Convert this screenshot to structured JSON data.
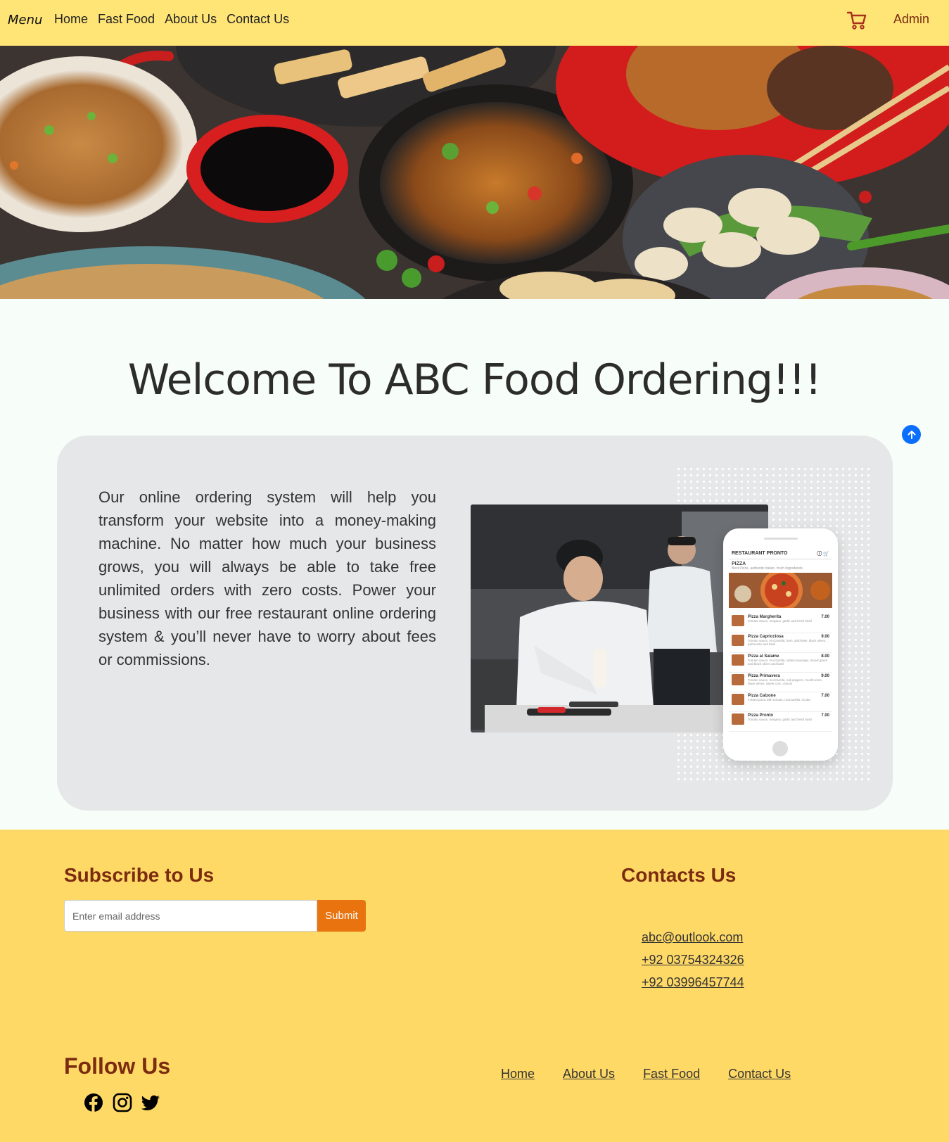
{
  "navbar": {
    "brand": "Menu",
    "links": [
      "Home",
      "Fast Food",
      "About Us",
      "Contact Us"
    ],
    "admin": "Admin",
    "cart_icon": "cart-icon",
    "accent_color": "#ffe476"
  },
  "hero": {
    "image": "food-dishes-banner"
  },
  "welcome": {
    "title": "Welcome To ABC Food Ordering!!!"
  },
  "about": {
    "text": "Our online ordering system will help you transform your website into a money-making machine. No matter how much your business grows, you will always be able to take free unlimited orders with zero costs. Power your business with our free restaurant online ordering system & you’ll never have to worry about fees or commissions.",
    "image": "chef-plating-photo",
    "phone": {
      "restaurant": "RESTAURANT PRONTO",
      "category": "PIZZA",
      "category_sub": "Best Pizza, authentic italian, fresh ingredients",
      "items": [
        {
          "name": "Pizza Margherita",
          "price": "7.00",
          "desc": "Tomato sauce, oregano, garlic and fresh basil"
        },
        {
          "name": "Pizza Capricciosa",
          "price": "9.00",
          "desc": "Tomato sauce, mozzarella, ham, artichoke, black olives, parmesan and basil"
        },
        {
          "name": "Pizza al Salame",
          "price": "8.00",
          "desc": "Tomato sauce, mozzarella, salami sausage, mixed green and black olives and basil"
        },
        {
          "name": "Pizza Primavera",
          "price": "9.00",
          "desc": "Tomato sauce, mozzarella, red peppers, mushrooms, black olives, sweet corn, onions"
        },
        {
          "name": "Pizza Calzone",
          "price": "7.00",
          "desc": "Folded pizza with tomato, mozzarella, ricotta"
        },
        {
          "name": "Pizza Pronto",
          "price": "7.00",
          "desc": "Tomato sauce, oregano, garlic and fresh basil"
        }
      ]
    }
  },
  "footer": {
    "subscribe_title": "Subscribe to Us",
    "email_placeholder": "Enter email address",
    "submit_label": "Submit",
    "contacts_title": "Contacts Us",
    "contacts": [
      "abc@outlook.com",
      "+92 03754324326",
      "+92 03996457744"
    ],
    "follow_title": "Follow Us",
    "social_icons": [
      "facebook-icon",
      "instagram-icon",
      "twitter-icon"
    ],
    "links": [
      "Home",
      "About Us",
      "Fast Food",
      "Contact Us"
    ],
    "background_color": "#ffd966",
    "heading_color": "#7a2b10",
    "button_color": "#e8730f"
  }
}
